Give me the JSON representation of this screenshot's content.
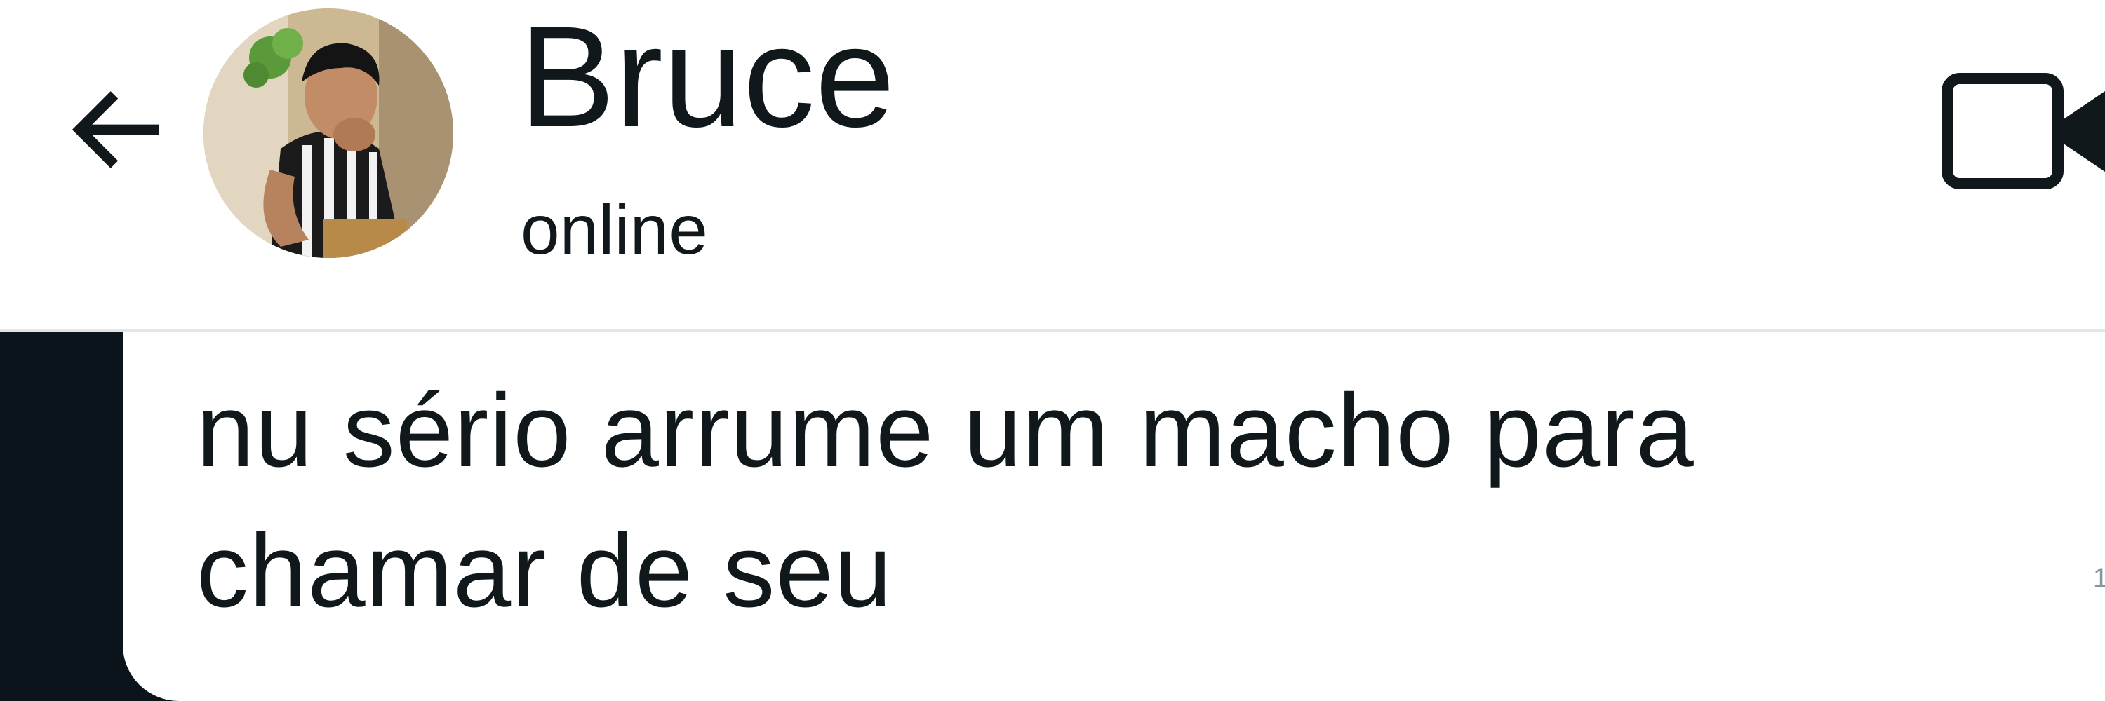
{
  "header": {
    "contact_name": "Bruce",
    "contact_status": "online",
    "back_icon": "arrow-left-icon",
    "video_icon": "video-camera-icon",
    "avatar_desc": "profile-photo"
  },
  "chat": {
    "messages": [
      {
        "direction": "incoming",
        "text_line1": "nu sério arrume um macho para",
        "text_line2": "chamar de seu",
        "meta": "1"
      }
    ]
  },
  "colors": {
    "text": "#11181c",
    "chat_background": "#0b141a",
    "bubble": "#ffffff",
    "divider": "#e3e6e8"
  }
}
